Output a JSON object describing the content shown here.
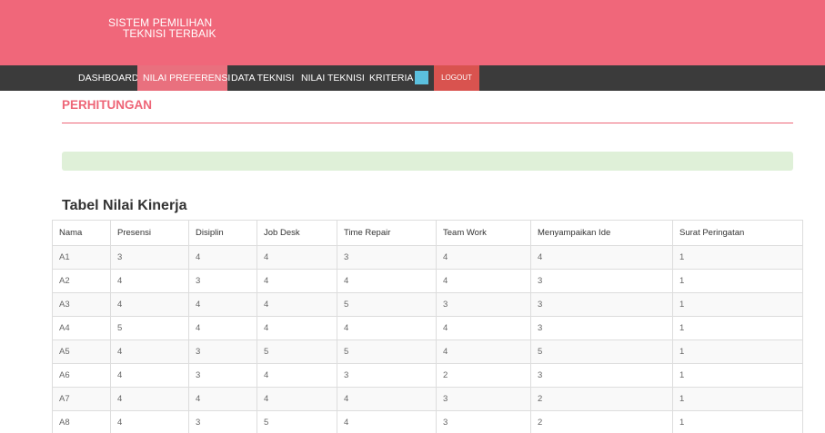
{
  "header": {
    "title_line1": "SISTEM PEMILIHAN",
    "title_line2": "TEKNISI TERBAIK"
  },
  "nav": {
    "items": [
      {
        "label": "DASHBOARD"
      },
      {
        "label": "NILAI PREFERENSI"
      },
      {
        "label": "DATA TEKNISI"
      },
      {
        "label": "NILAI TEKNISI"
      },
      {
        "label": "KRITERIA"
      }
    ],
    "active_index": 1,
    "logout_label": "LOGOUT"
  },
  "page": {
    "section_title": "PERHITUNGAN",
    "table_title": "Tabel Nilai Kinerja"
  },
  "colors": {
    "header": "#f0677a",
    "navbar": "#3b3b3b",
    "active_nav": "#e9707e",
    "logout": "#d9534f",
    "swatch": "#5bc0de",
    "alert": "#dff0d8"
  },
  "table": {
    "columns": [
      "Nama",
      "Presensi",
      "Disiplin",
      "Job Desk",
      "Time Repair",
      "Team Work",
      "Menyampaikan Ide",
      "Surat Peringatan"
    ],
    "rows": [
      [
        "A1",
        "3",
        "4",
        "4",
        "3",
        "4",
        "4",
        "1"
      ],
      [
        "A2",
        "4",
        "3",
        "4",
        "4",
        "4",
        "3",
        "1"
      ],
      [
        "A3",
        "4",
        "4",
        "4",
        "5",
        "3",
        "3",
        "1"
      ],
      [
        "A4",
        "5",
        "4",
        "4",
        "4",
        "4",
        "3",
        "1"
      ],
      [
        "A5",
        "4",
        "3",
        "5",
        "5",
        "4",
        "5",
        "1"
      ],
      [
        "A6",
        "4",
        "3",
        "4",
        "3",
        "2",
        "3",
        "1"
      ],
      [
        "A7",
        "4",
        "4",
        "4",
        "4",
        "3",
        "2",
        "1"
      ],
      [
        "A8",
        "4",
        "3",
        "5",
        "4",
        "3",
        "2",
        "1"
      ]
    ]
  }
}
